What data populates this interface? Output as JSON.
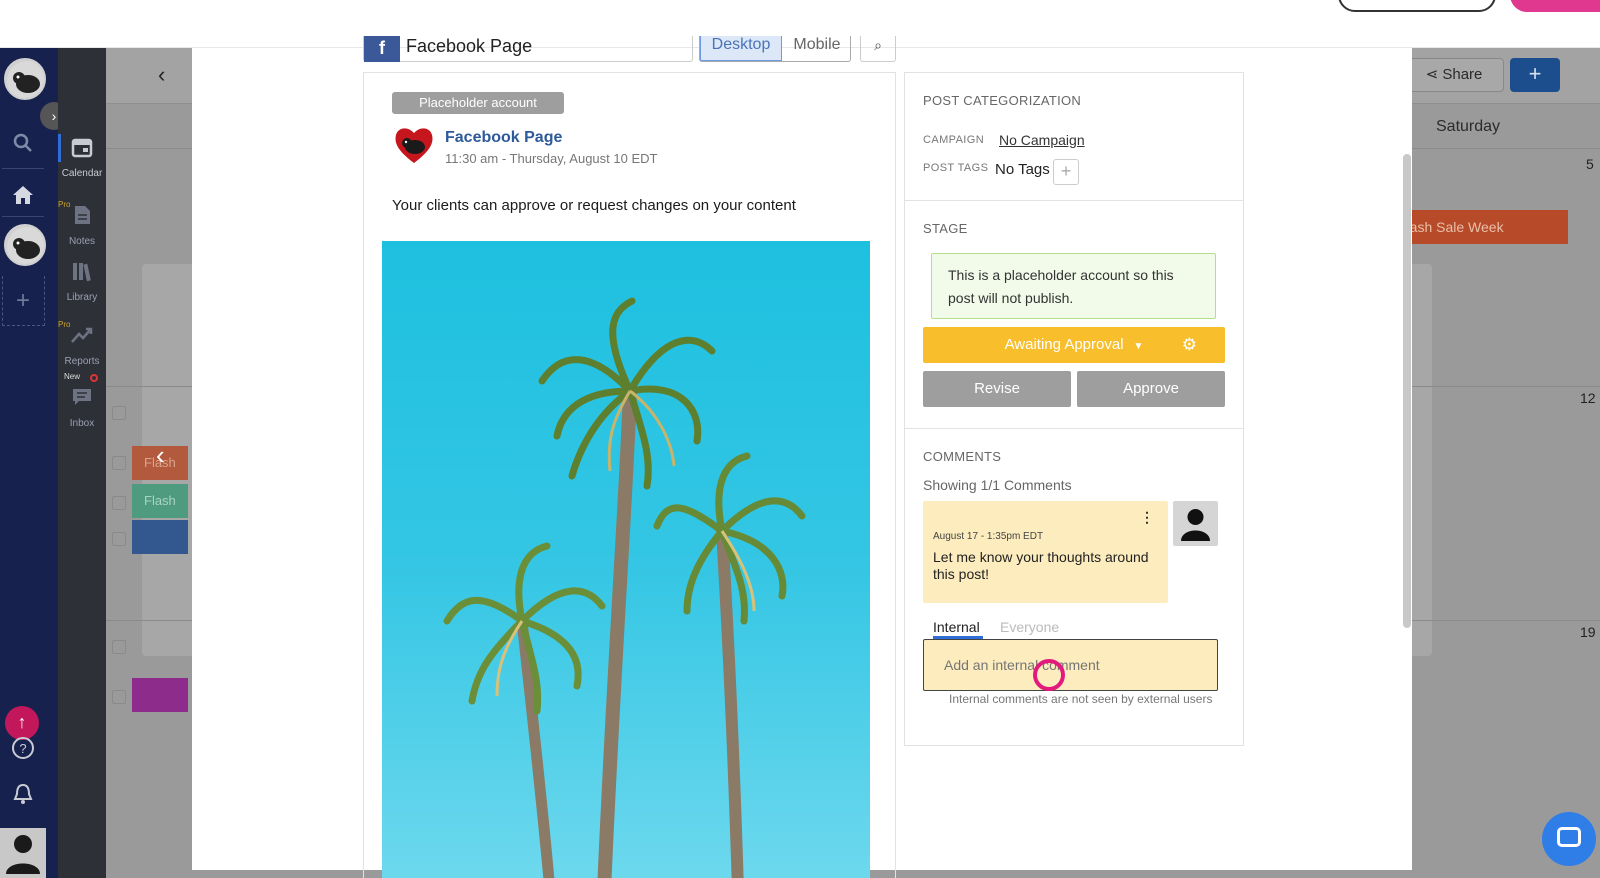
{
  "calendar": {
    "share_label": "Share",
    "plus_label": "+",
    "saturday_label": "Saturday",
    "day_numbers": [
      "5",
      "12",
      "19"
    ],
    "flash_event": "Flash Sale Week",
    "stub_events": [
      "Flash S",
      "Flash S"
    ]
  },
  "subnav": {
    "calendar": "Calendar",
    "notes": "Notes",
    "library": "Library",
    "reports": "Reports",
    "inbox": "Inbox",
    "pro": "Pro",
    "new": "New"
  },
  "modal": {
    "account_selector": "Facebook Page",
    "view_desktop": "Desktop",
    "view_mobile": "Mobile",
    "placeholder_badge": "Placeholder account",
    "page_name": "Facebook Page",
    "post_time": "11:30 am - Thursday, August 10 EDT",
    "post_text": "Your clients can approve or request changes on your content"
  },
  "categorization": {
    "title": "POST CATEGORIZATION",
    "campaign_label": "CAMPAIGN",
    "campaign_value": "No Campaign",
    "tags_label": "POST TAGS",
    "tags_value": "No Tags"
  },
  "stage": {
    "title": "STAGE",
    "note": "This is a placeholder account so this post will not publish.",
    "status_button": "Awaiting Approval",
    "revise_button": "Revise",
    "approve_button": "Approve"
  },
  "comments": {
    "title": "COMMENTS",
    "showing": "Showing 1/1 Comments",
    "items": [
      {
        "date": "August 17 - 1:35pm EDT",
        "body": "Let me know your thoughts around this post!"
      }
    ],
    "tab_internal": "Internal",
    "tab_everyone": "Everyone",
    "input_placeholder": "Add an internal comment",
    "input_note": "Internal comments are not seen by external users"
  },
  "colors": {
    "approval": "#f8be2c",
    "note_bg": "#f2fbe9",
    "comment_bg": "#fdecbd",
    "brand_link": "#2e5a9a",
    "cursor": "#e3197e"
  }
}
